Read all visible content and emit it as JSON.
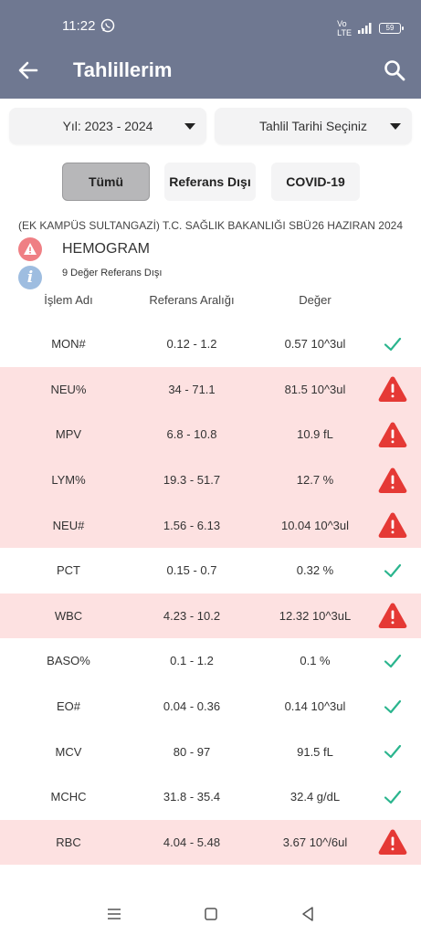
{
  "status_bar": {
    "time": "11:22",
    "battery": "59"
  },
  "app_bar": {
    "title": "Tahlillerim"
  },
  "filters": {
    "year": "Yıl: 2023 - 2024",
    "date_picker": "Tahlil Tarihi Seçiniz",
    "tabs": [
      "Tümü",
      "Referans Dışı",
      "COVID-19"
    ],
    "selected_tab": "Tümü"
  },
  "report": {
    "lab": "(EK KAMPÜS SULTANGAZİ) T.C. SAĞLIK BAKANLIĞI SBÜ",
    "date": "26 HAZIRAN 2024",
    "test_name": "HEMOGRAM",
    "out_of_range_count": "9 Değer Referans Dışı"
  },
  "table": {
    "headers": [
      "İşlem Adı",
      "Referans Aralığı",
      "Değer"
    ],
    "rows": [
      {
        "name": "MON#",
        "range": "0.12 - 1.2",
        "value": "0.57 10^3ul",
        "status": "ok"
      },
      {
        "name": "NEU%",
        "range": "34 - 71.1",
        "value": "81.5 10^3ul",
        "status": "out"
      },
      {
        "name": "MPV",
        "range": "6.8 - 10.8",
        "value": "10.9 fL",
        "status": "out"
      },
      {
        "name": "LYM%",
        "range": "19.3 - 51.7",
        "value": "12.7 %",
        "status": "out"
      },
      {
        "name": "NEU#",
        "range": "1.56 - 6.13",
        "value": "10.04 10^3ul",
        "status": "out"
      },
      {
        "name": "PCT",
        "range": "0.15 - 0.7",
        "value": "0.32 %",
        "status": "ok"
      },
      {
        "name": "WBC",
        "range": "4.23 - 10.2",
        "value": "12.32 10^3uL",
        "status": "out"
      },
      {
        "name": "BASO%",
        "range": "0.1 - 1.2",
        "value": "0.1 %",
        "status": "ok"
      },
      {
        "name": "EO#",
        "range": "0.04 - 0.36",
        "value": "0.14 10^3ul",
        "status": "ok"
      },
      {
        "name": "MCV",
        "range": "80 - 97",
        "value": "91.5 fL",
        "status": "ok"
      },
      {
        "name": "MCHC",
        "range": "31.8 - 35.4",
        "value": "32.4 g/dL",
        "status": "ok"
      },
      {
        "name": "RBC",
        "range": "4.04 - 5.48",
        "value": "3.67 10^/6ul",
        "status": "out"
      }
    ]
  },
  "icons": {
    "ok": "check-icon",
    "out": "warning-triangle-icon",
    "info": "info-icon"
  },
  "colors": {
    "app_bar": "#6f7891",
    "out_row_bg": "#fde1e1",
    "ok_check": "#2bb58e",
    "warn_red": "#e53935",
    "warn_circle": "#ef7f84",
    "info_circle": "#9ebde0"
  }
}
